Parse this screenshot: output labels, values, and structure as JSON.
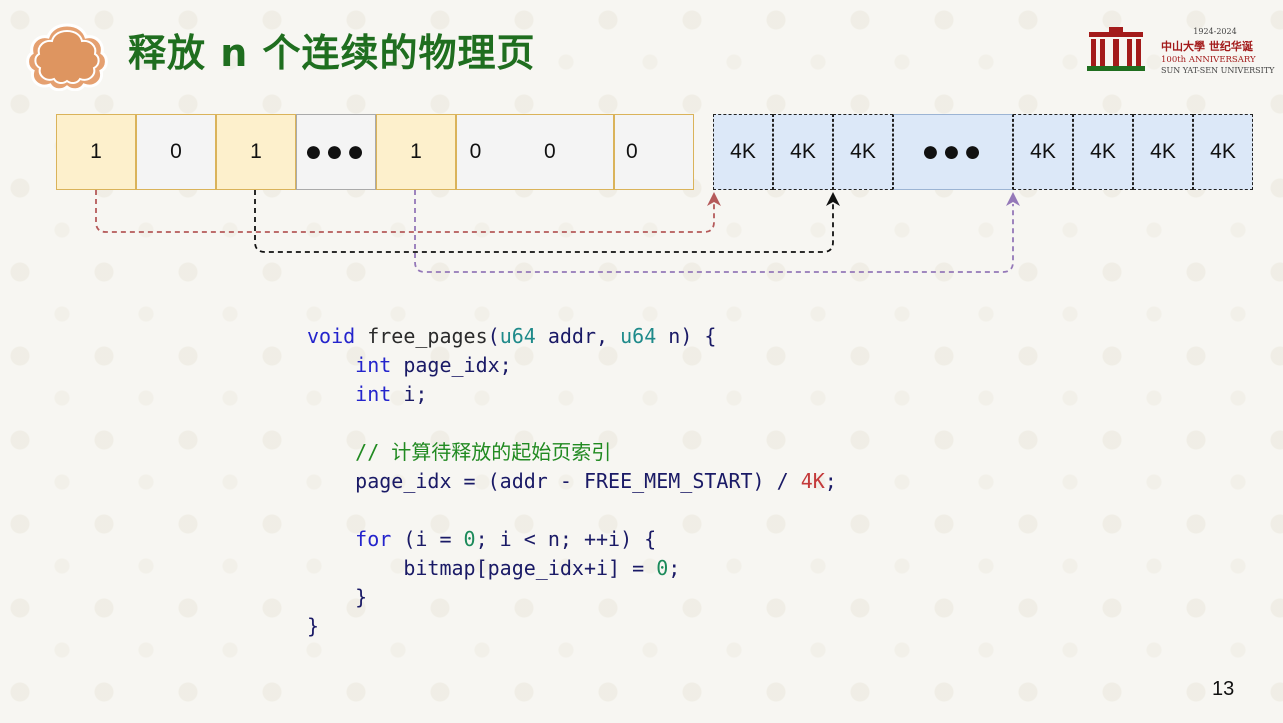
{
  "title": "释放 n 个连续的物理页",
  "logo": {
    "years": "1924-2024",
    "chinese": "中山大學 世纪华诞",
    "anniversary": "100th ANNIVERSARY",
    "university": "SUN YAT-SEN UNIVERSITY"
  },
  "bitmap_cells": [
    "1",
    "0",
    "1",
    "●●●",
    "1",
    "0",
    "0",
    "0"
  ],
  "memory_cells": [
    "4K",
    "4K",
    "4K",
    "●●●",
    "4K",
    "4K",
    "4K",
    "4K"
  ],
  "colors": {
    "title": "#1f6e1f",
    "bitmap_used": "#fdf0cc",
    "memory_page": "#dce8f8",
    "arrow_red": "#b55a5a",
    "arrow_black": "#111111",
    "arrow_purple": "#9478b8"
  },
  "code": {
    "signature": {
      "kw_void": "void",
      "fn_name": "free_pages",
      "open": "(",
      "type1": "u64",
      "param1": " addr, ",
      "type2": "u64",
      "param2": " n) {"
    },
    "decl1": {
      "kw": "int",
      "rest": " page_idx;"
    },
    "decl2": {
      "kw": "int",
      "rest": " i;"
    },
    "comment": "// 计算待释放的起始页索引",
    "assign": {
      "lhs": "page_idx = (addr - FREE_MEM_START) / ",
      "num": "4K",
      "end": ";"
    },
    "loop": {
      "kw": "for",
      "a": " (i = ",
      "zero": "0",
      "b": "; i < n; ++i) {"
    },
    "body": {
      "lhs": "bitmap[page_idx+i] = ",
      "zero": "0",
      "end": ";"
    },
    "close_inner": "}",
    "close_outer": "}"
  },
  "page_number": "13"
}
